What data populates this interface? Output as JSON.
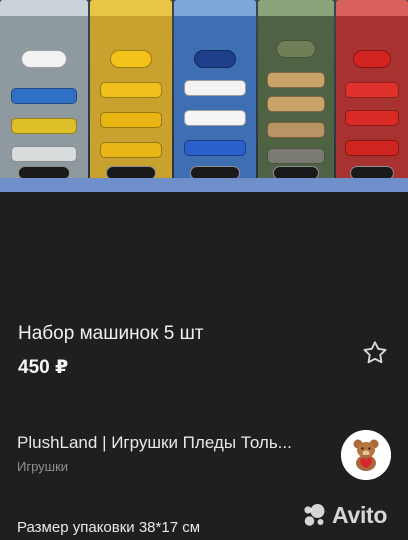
{
  "listing": {
    "title": "Набор машинок 5 шт",
    "price": "450 ₽",
    "favorite_icon": "star-outline-icon"
  },
  "seller": {
    "name": "PlushLand | Игрушки Пледы Толь...",
    "category": "Игрушки",
    "avatar_icon": "teddy-bear-avatar"
  },
  "details": {
    "package_size": "Размер упаковки 38*17 см"
  },
  "watermark": {
    "text": "Avito"
  },
  "photo": {
    "description_icon": "toy-car-sets-photo",
    "pack_colors": [
      "#8e9aa0",
      "#c9a12e",
      "#3f6fb3",
      "#4f6244",
      "#a8322f"
    ]
  }
}
